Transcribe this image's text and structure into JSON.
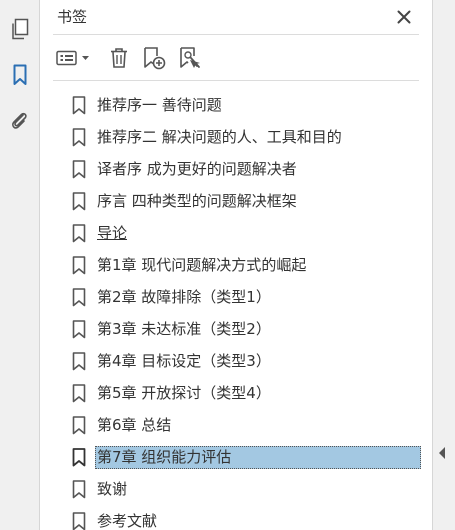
{
  "panel": {
    "title": "书签"
  },
  "rail": {
    "icons": [
      "pages-icon",
      "bookmark-icon",
      "attachment-icon"
    ],
    "active_color": "#2b6fb3"
  },
  "toolbar": {
    "icons": [
      "options-menu-icon",
      "delete-icon",
      "new-bookmark-icon",
      "find-bookmark-icon"
    ]
  },
  "bookmarks": [
    {
      "label": "推荐序一 善待问题"
    },
    {
      "label": "推荐序二 解决问题的人、工具和目的"
    },
    {
      "label": "译者序 成为更好的问题解决者"
    },
    {
      "label": "序言 四种类型的问题解决框架"
    },
    {
      "label": "导论"
    },
    {
      "label": "第1章 现代问题解决方式的崛起"
    },
    {
      "label": "第2章 故障排除（类型1）"
    },
    {
      "label": "第3章 未达标准（类型2）"
    },
    {
      "label": "第4章 目标设定（类型3）"
    },
    {
      "label": "第5章 开放探讨（类型4）"
    },
    {
      "label": "第6章 总结"
    },
    {
      "label": "第7章 组织能力评估"
    },
    {
      "label": "致谢"
    },
    {
      "label": "参考文献"
    }
  ],
  "selected_index": 11,
  "colors": {
    "selection": "#a3c8e2",
    "text": "#333333",
    "icon": "#555555"
  }
}
